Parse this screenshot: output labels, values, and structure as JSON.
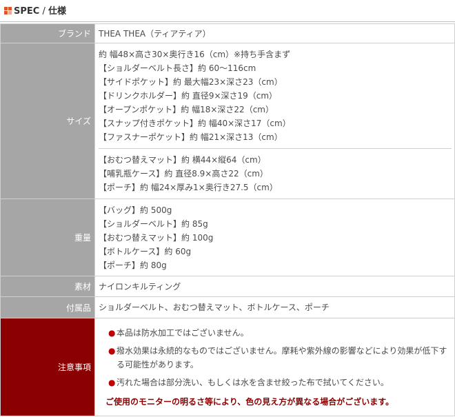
{
  "header": {
    "title_en": "SPEC",
    "separator": " / ",
    "title_ja": "仕様"
  },
  "rows": {
    "brand": {
      "label": "ブランド",
      "value": "THEA THEA（ティアティア）"
    },
    "size": {
      "label": "サイズ",
      "group1": [
        "約 幅48×高さ30×奥行き16（cm）※持ち手含まず",
        "【ショルダーベルト長さ】約 60〜116cm",
        "【サイドポケット】約 最大幅23×深さ23（cm）",
        "【ドリンクホルダー】約 直径9×深さ19（cm）",
        "【オープンポケット】約 幅18×深さ22（cm）",
        "【スナップ付きポケット】約 幅40×深さ17（cm）",
        "【ファスナーポケット】約 幅21×深さ13（cm）"
      ],
      "group2": [
        "【おむつ替えマット】約 横44×縦64（cm）",
        "【哺乳瓶ケース】約 直径8.9×高さ22（cm）",
        "【ポーチ】約 幅24×厚み1×奥行き27.5（cm）"
      ]
    },
    "weight": {
      "label": "重量",
      "lines": [
        "【バッグ】約 500g",
        "【ショルダーベルト】約 85g",
        "【おむつ替えマット】約 100g",
        "【ボトルケース】約 60g",
        "【ポーチ】約 80g"
      ]
    },
    "material": {
      "label": "素材",
      "value": "ナイロンキルティング"
    },
    "accessories": {
      "label": "付属品",
      "value": "ショルダーベルト、おむつ替えマット、ボトルケース、ポーチ"
    },
    "notes": {
      "label": "注意事項",
      "bullet": "●",
      "items": [
        "本品は防水加工ではございません。",
        "撥水効果は永続的なものではございません。摩耗や紫外線の影響などにより効果が低下する可能性があります。",
        "汚れた場合は部分洗い、もしくは水を含ませ絞った布で拭いてください。"
      ],
      "bold_note": "ご使用のモニターの明るさ等により、色の見え方が異なる場合がございます。"
    }
  },
  "colors": {
    "label_bg": "#a6a6a6",
    "notes_label_bg": "#8b0000",
    "bullet": "#c00000",
    "accent": "#d8562a"
  }
}
